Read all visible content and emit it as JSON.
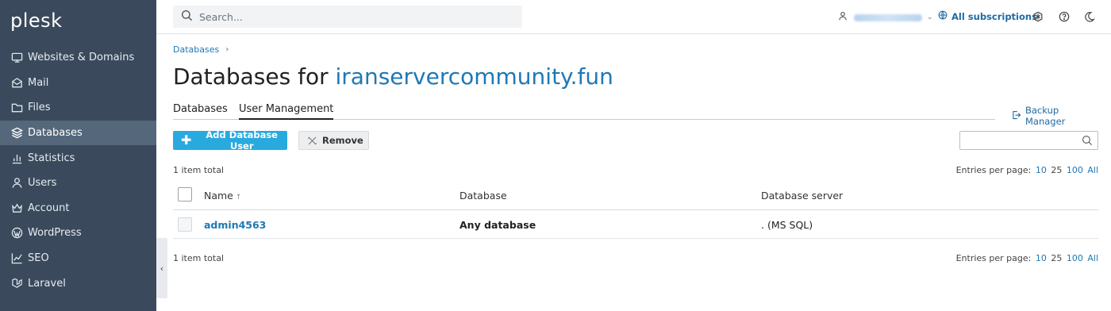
{
  "app": {
    "logo": "plesk"
  },
  "sidebar": {
    "items": [
      {
        "label": "Websites & Domains",
        "icon": "monitor-icon",
        "active": false
      },
      {
        "label": "Mail",
        "icon": "mail-icon",
        "active": false
      },
      {
        "label": "Files",
        "icon": "folder-icon",
        "active": false
      },
      {
        "label": "Databases",
        "icon": "layers-icon",
        "active": true
      },
      {
        "label": "Statistics",
        "icon": "bar-chart-icon",
        "active": false
      },
      {
        "label": "Users",
        "icon": "user-icon",
        "active": false
      },
      {
        "label": "Account",
        "icon": "crown-icon",
        "active": false
      },
      {
        "label": "WordPress",
        "icon": "wordpress-icon",
        "active": false
      },
      {
        "label": "SEO",
        "icon": "seo-chart-icon",
        "active": false
      },
      {
        "label": "Laravel",
        "icon": "laravel-icon",
        "active": false
      }
    ]
  },
  "topbar": {
    "search_placeholder": "Search...",
    "subscriptions_label": "All subscriptions"
  },
  "breadcrumb": {
    "item": "Databases"
  },
  "page": {
    "title_prefix": "Databases for ",
    "title_domain": "iranservercommunity.fun"
  },
  "tabs": [
    {
      "label": "Databases",
      "active": false
    },
    {
      "label": "User Management",
      "active": true
    }
  ],
  "backup_manager_label": "Backup Manager",
  "toolbar": {
    "add_label": "Add Database User",
    "remove_label": "Remove"
  },
  "list": {
    "total_top": "1 item total",
    "total_bottom": "1 item total",
    "entries_label": "Entries per page:",
    "entries_options": [
      "10",
      "25",
      "100",
      "All"
    ],
    "entries_current": "25",
    "columns": {
      "name": "Name",
      "database": "Database",
      "server": "Database server"
    },
    "sort_indicator": "↑",
    "rows": [
      {
        "name": "admin4563",
        "database": "Any database",
        "server": ". (MS SQL)"
      }
    ]
  },
  "colors": {
    "sidebar_bg": "#3a4a5c",
    "sidebar_active": "#55687b",
    "accent": "#28aadf",
    "link": "#1f78b4"
  }
}
